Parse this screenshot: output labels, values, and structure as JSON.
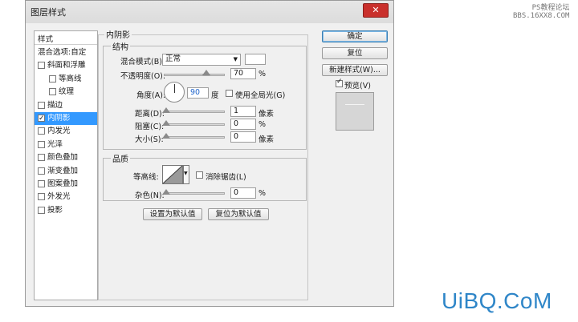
{
  "dialog": {
    "title": "图层样式",
    "close_icon": "✕"
  },
  "sidebar": {
    "header": "样式",
    "items": [
      {
        "label": "混合选项:自定",
        "checkbox": false,
        "checked": false,
        "selected": false
      },
      {
        "label": "斜面和浮雕",
        "checkbox": true,
        "checked": false,
        "selected": false
      },
      {
        "label": "等高线",
        "checkbox": true,
        "checked": false,
        "selected": false
      },
      {
        "label": "纹理",
        "checkbox": true,
        "checked": false,
        "selected": false
      },
      {
        "label": "描边",
        "checkbox": true,
        "checked": false,
        "selected": false
      },
      {
        "label": "内阴影",
        "checkbox": true,
        "checked": true,
        "selected": true
      },
      {
        "label": "内发光",
        "checkbox": true,
        "checked": false,
        "selected": false
      },
      {
        "label": "光泽",
        "checkbox": true,
        "checked": false,
        "selected": false
      },
      {
        "label": "颜色叠加",
        "checkbox": true,
        "checked": false,
        "selected": false
      },
      {
        "label": "渐变叠加",
        "checkbox": true,
        "checked": false,
        "selected": false
      },
      {
        "label": "图案叠加",
        "checkbox": true,
        "checked": false,
        "selected": false
      },
      {
        "label": "外发光",
        "checkbox": true,
        "checked": false,
        "selected": false
      },
      {
        "label": "投影",
        "checkbox": true,
        "checked": false,
        "selected": false
      }
    ]
  },
  "panel": {
    "title": "内阴影",
    "structure": {
      "title": "结构",
      "blend_mode_label": "混合模式(B):",
      "blend_mode_value": "正常",
      "opacity_label": "不透明度(O):",
      "opacity_value": "70",
      "opacity_unit": "%",
      "angle_label": "角度(A):",
      "angle_value": "90",
      "angle_unit": "度",
      "global_light_label": "使用全局光(G)",
      "global_light_checked": false,
      "distance_label": "距离(D):",
      "distance_value": "1",
      "distance_unit": "像素",
      "choke_label": "阻塞(C):",
      "choke_value": "0",
      "choke_unit": "%",
      "size_label": "大小(S):",
      "size_value": "0",
      "size_unit": "像素",
      "shadow_color": "#ffffff"
    },
    "quality": {
      "title": "品质",
      "contour_label": "等高线:",
      "antialias_label": "消除锯齿(L)",
      "antialias_checked": false,
      "noise_label": "杂色(N):",
      "noise_value": "0",
      "noise_unit": "%"
    },
    "set_default_label": "设置为默认值",
    "reset_default_label": "复位为默认值"
  },
  "buttons": {
    "ok": "确定",
    "reset": "复位",
    "new_style": "新建样式(W)...",
    "preview_label": "预览(V)",
    "preview_checked": true
  },
  "watermarks": {
    "top_line1": "PS教程论坛",
    "top_line2": "BBS.16XX8.COM",
    "bottom": "UiBQ.CoM"
  },
  "colors": {
    "selection": "#3399ff",
    "watermark": "#2f86c8"
  }
}
